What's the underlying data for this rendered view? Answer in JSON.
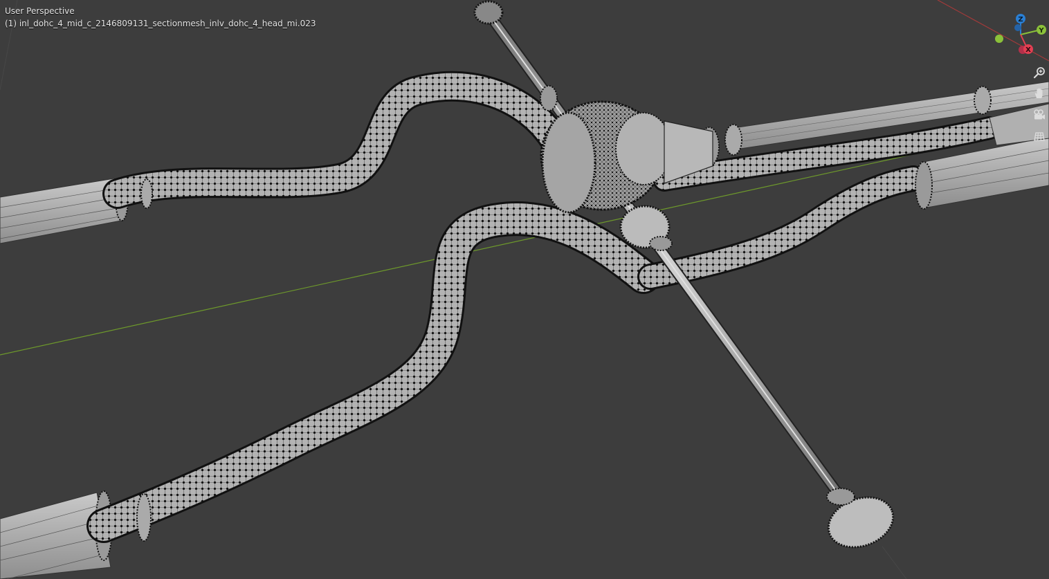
{
  "viewport": {
    "view_mode": "User Perspective",
    "object_info": "(1) inl_dohc_4_mid_c_2146809131_sectionmesh_inlv_dohc_4_head_mi.023",
    "background_color": "#3d3d3d"
  },
  "gizmo": {
    "z_label": "Z",
    "y_label": "Y",
    "x_label": "X",
    "z_color": "#2a7fd4",
    "y_color": "#8bc13a",
    "x_color": "#e23f52"
  },
  "nav_buttons": [
    {
      "name": "zoom",
      "icon": "magnifier-plus-icon"
    },
    {
      "name": "pan",
      "icon": "hand-icon"
    },
    {
      "name": "camera",
      "icon": "camera-icon"
    },
    {
      "name": "ortho",
      "icon": "grid-icon"
    }
  ],
  "axis_colors": {
    "x_axis_line": "#a33a3a",
    "y_axis_line": "#6e9a2b"
  }
}
